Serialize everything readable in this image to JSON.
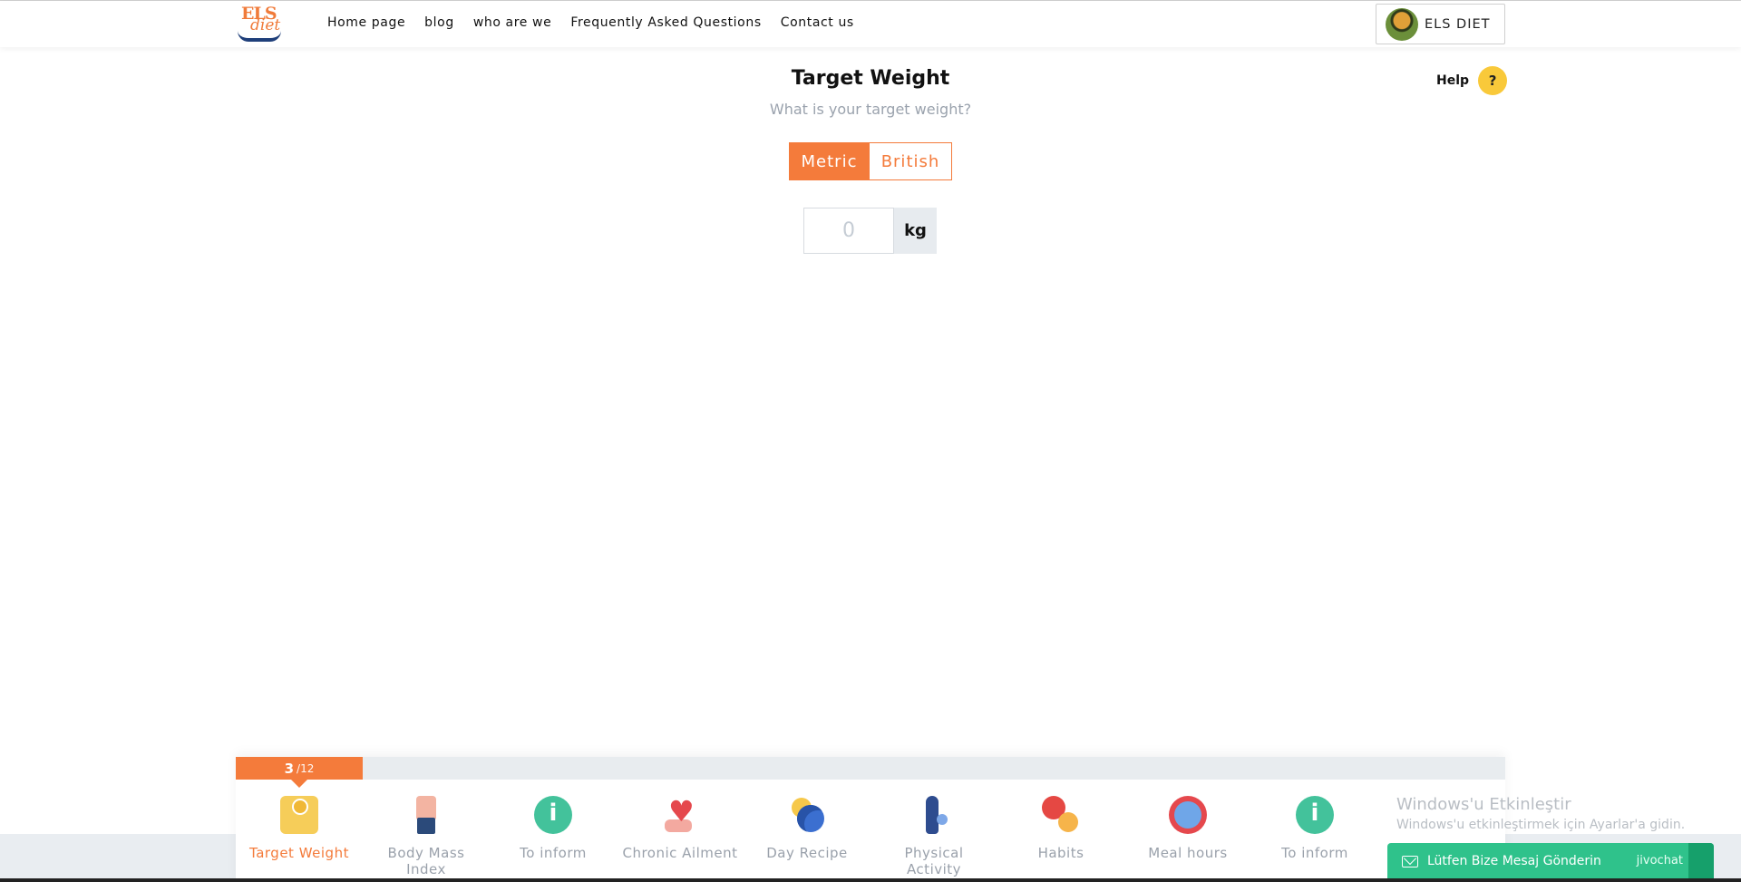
{
  "brand": {
    "logo_text_1": "ELS",
    "logo_text_2": "diet",
    "user_label": "ELS DIET"
  },
  "nav": {
    "items": [
      "Home page",
      "blog",
      "who are we",
      "Frequently Asked Questions",
      "Contact us"
    ]
  },
  "help": {
    "label": "Help",
    "icon_text": "?"
  },
  "main": {
    "title": "Target Weight",
    "subtitle": "What is your target weight?",
    "unit_options": [
      "Metric",
      "British"
    ],
    "selected_unit": "Metric",
    "weight_input": {
      "value": "",
      "placeholder": "0"
    },
    "unit_label": "kg"
  },
  "progress": {
    "current": "3",
    "total": "12",
    "fraction": 0.0833
  },
  "steps": [
    {
      "label": "Target Weight",
      "icon": "scale-icon",
      "active": true
    },
    {
      "label": "Body Mass Index",
      "icon": "body-icon",
      "active": false
    },
    {
      "label": "To inform",
      "icon": "info-icon",
      "active": false
    },
    {
      "label": "Chronic Ailment",
      "icon": "heart-hand-icon",
      "active": false
    },
    {
      "label": "Day Recipe",
      "icon": "sun-moon-icon",
      "active": false
    },
    {
      "label": "Physical Activity",
      "icon": "fitness-icon",
      "active": false
    },
    {
      "label": "Habits",
      "icon": "habits-icon",
      "active": false
    },
    {
      "label": "Meal hours",
      "icon": "clock-icon",
      "active": false
    },
    {
      "label": "To inform",
      "icon": "info-icon",
      "active": false
    }
  ],
  "os_watermark": {
    "line1": "Windows'u Etkinleştir",
    "line2": "Windows'u etkinleştirmek için Ayarlar'a gidin."
  },
  "chat": {
    "label": "Lütfen Bize Mesaj Gönderin",
    "brand": "jivochat"
  },
  "colors": {
    "accent": "#f47b3b",
    "help_yellow": "#f9c93a",
    "chat_green": "#2fc28b",
    "muted_text": "#9aa2ad"
  }
}
